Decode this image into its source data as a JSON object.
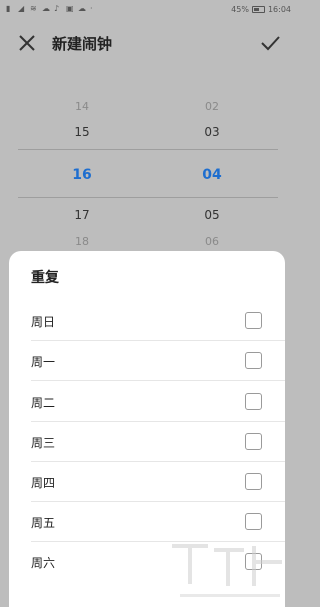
{
  "status_bar": {
    "left_icons": [
      "sim-icon",
      "signal-icon",
      "wifi-icon",
      "cloud-icon",
      "tiktok-icon",
      "image-icon",
      "cloud-icon-2",
      "more-icon"
    ],
    "battery_percent": "45%",
    "time": "16:04"
  },
  "header": {
    "title": "新建闹钟"
  },
  "picker": {
    "hours": [
      "14",
      "15",
      "16",
      "17",
      "18"
    ],
    "minutes": [
      "02",
      "03",
      "04",
      "05",
      "06"
    ],
    "selected_hour": "16",
    "selected_minute": "04"
  },
  "repeat_sheet": {
    "title": "重复",
    "days": [
      {
        "label": "周日",
        "checked": false
      },
      {
        "label": "周一",
        "checked": false
      },
      {
        "label": "周二",
        "checked": false
      },
      {
        "label": "周三",
        "checked": false
      },
      {
        "label": "周四",
        "checked": false
      },
      {
        "label": "周五",
        "checked": false
      },
      {
        "label": "周六",
        "checked": false
      }
    ]
  },
  "colors": {
    "accent": "#1e6ecf",
    "overlay": "#bdbdbd",
    "sheet": "#ffffff"
  }
}
